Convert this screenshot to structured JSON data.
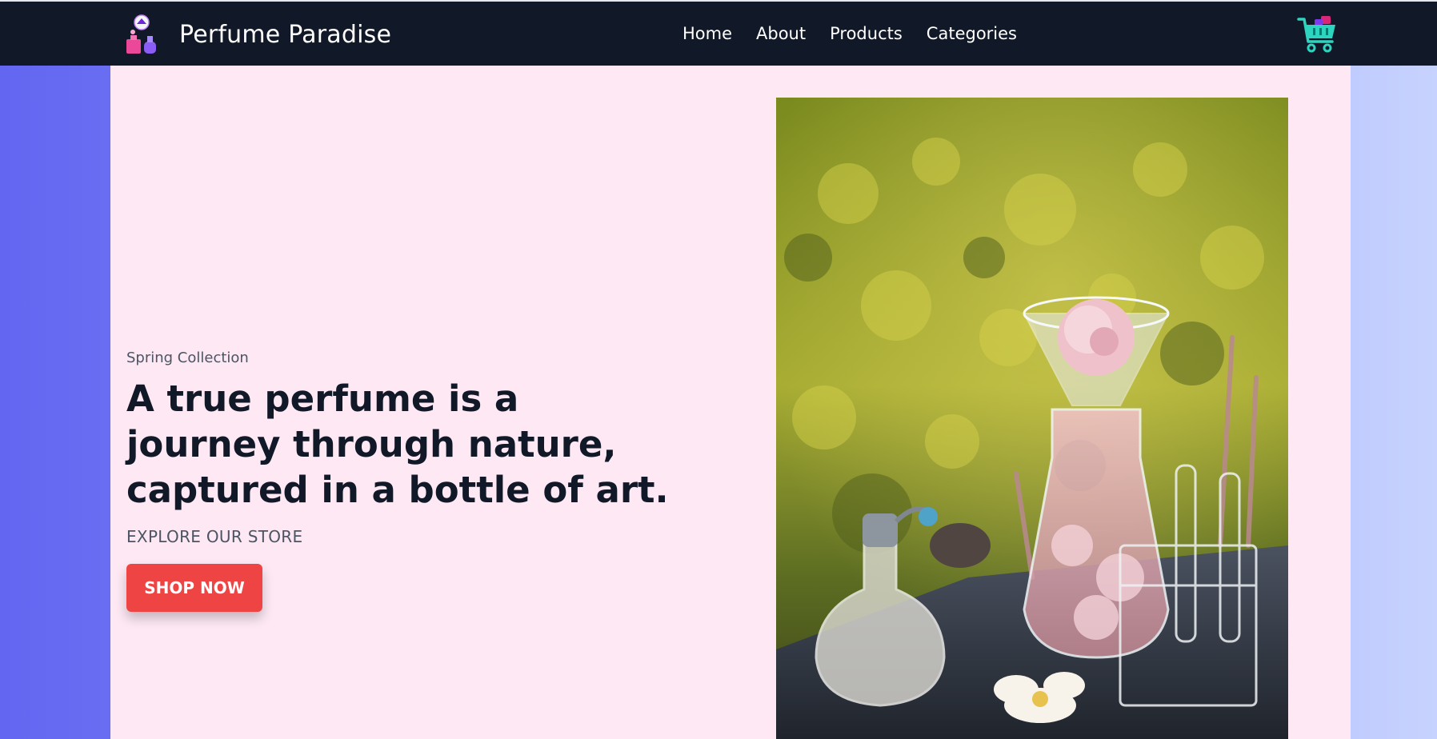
{
  "navbar": {
    "brand_name": "Perfume Paradise",
    "brand_logo_icon": "perfume-bottles-icon",
    "links": [
      {
        "label": "Home"
      },
      {
        "label": "About"
      },
      {
        "label": "Products"
      },
      {
        "label": "Categories"
      }
    ],
    "cart_icon": "shopping-cart-icon"
  },
  "hero": {
    "eyebrow": "Spring Collection",
    "headline": "A true perfume is a journey through nature, captured in a bottle of art.",
    "subtext": "EXPLORE OUR STORE",
    "cta_label": "SHOP NOW",
    "image": "perfume-bottles-with-roses-in-field-photo"
  },
  "colors": {
    "navbar_bg": "#111827",
    "content_bg": "#fde8f3",
    "cta_bg": "#ef4444",
    "cart_accent": "#2dd4bf",
    "gradient_left": "#6366f1",
    "gradient_right": "#c7d2fe"
  }
}
